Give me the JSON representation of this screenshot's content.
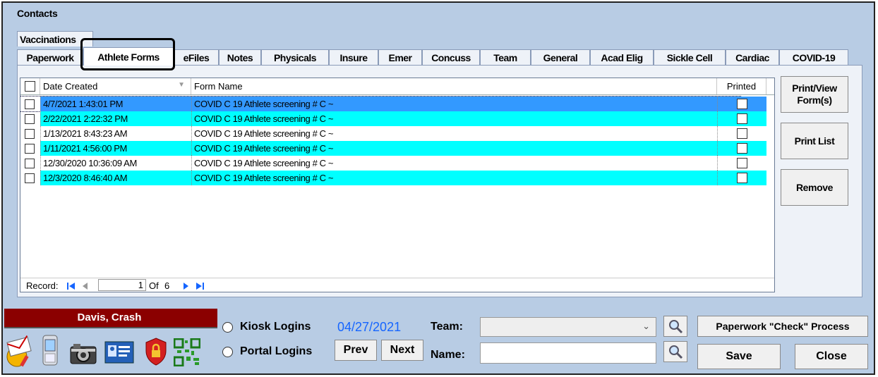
{
  "section_title": "Contacts",
  "tabs_row1": [
    {
      "label": "Vaccinations"
    }
  ],
  "tabs_row2": [
    {
      "label": "Paperwork"
    },
    {
      "label": "Athlete Forms"
    },
    {
      "label": "eFiles"
    },
    {
      "label": "Notes"
    },
    {
      "label": "Physicals"
    },
    {
      "label": "Insure"
    },
    {
      "label": "Emer"
    },
    {
      "label": "Concuss"
    },
    {
      "label": "Team"
    },
    {
      "label": "General"
    },
    {
      "label": "Acad Elig"
    },
    {
      "label": "Sickle Cell"
    },
    {
      "label": "Cardiac"
    },
    {
      "label": "COVID-19"
    }
  ],
  "active_tab": "Athlete Forms",
  "grid": {
    "columns": [
      {
        "label": "Date Created"
      },
      {
        "label": "Form Name"
      },
      {
        "label": "Printed"
      }
    ],
    "rows": [
      {
        "date": "4/7/2021 1:43:01 PM",
        "form": "COVID C 19 Athlete screening  # C  ~"
      },
      {
        "date": "2/22/2021 2:22:32 PM",
        "form": "COVID C 19 Athlete screening  # C  ~"
      },
      {
        "date": "1/13/2021 8:43:23 AM",
        "form": "COVID C 19 Athlete screening  # C  ~"
      },
      {
        "date": "1/11/2021 4:56:00 PM",
        "form": "COVID C 19 Athlete screening  # C  ~"
      },
      {
        "date": "12/30/2020 10:36:09 AM",
        "form": "COVID C 19 Athlete screening  # C  ~"
      },
      {
        "date": "12/3/2020 8:46:40 AM",
        "form": "COVID C 19 Athlete screening  # C  ~"
      }
    ],
    "row_colors": [
      "#3399ff",
      "#00ffff",
      "#ffffff",
      "#00ffff",
      "#ffffff",
      "#00ffff"
    ],
    "record_label": "Record:",
    "record_current": "1",
    "record_of": "Of",
    "record_total": "6"
  },
  "side_buttons": {
    "print_view": "Print/View Form(s)",
    "print_list": "Print List",
    "remove": "Remove"
  },
  "bottom": {
    "athlete_name": "Davis, Crash",
    "kiosk_label": "Kiosk Logins",
    "portal_label": "Portal Logins",
    "date": "04/27/2021",
    "prev": "Prev",
    "next": "Next",
    "team_label": "Team:",
    "name_label": "Name:",
    "team_value": "",
    "name_value": "",
    "paperwork_check": "Paperwork \"Check\" Process",
    "save": "Save",
    "close": "Close"
  },
  "colors": {
    "frame_bg": "#b8cce4",
    "name_banner": "#8b0000",
    "date_blue": "#1565ff",
    "selected_row": "#3399ff",
    "alt_row": "#00ffff"
  },
  "icons": [
    "envelope-pencil-icon",
    "mobile-phone-icon",
    "camera-icon",
    "id-card-icon",
    "shield-lock-icon",
    "qr-code-icon",
    "magnifier-icon"
  ]
}
